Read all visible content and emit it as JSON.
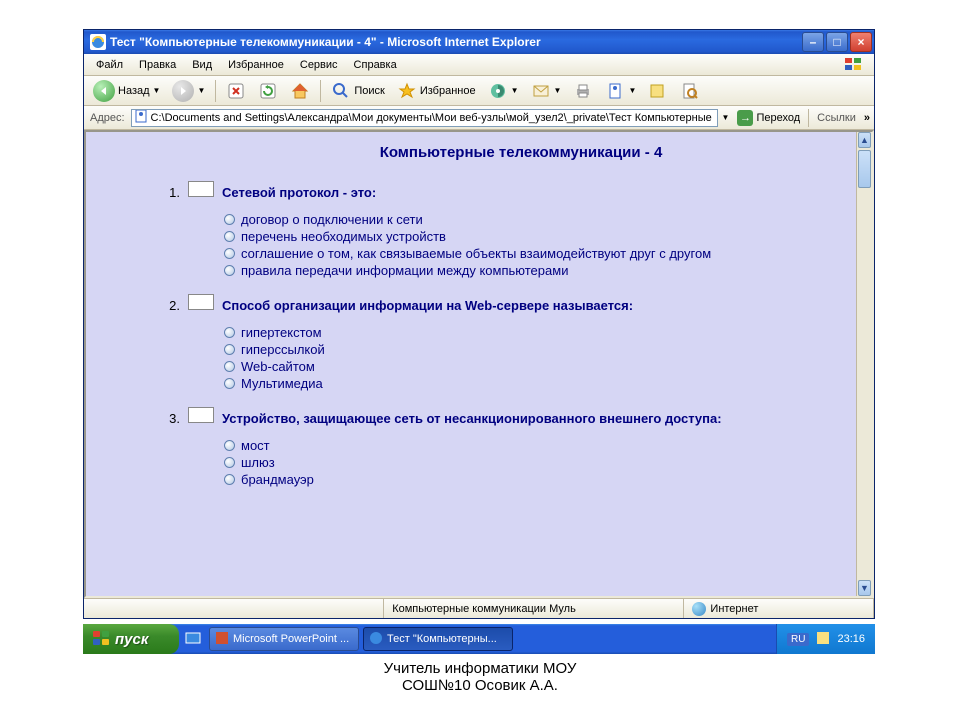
{
  "window": {
    "title": "Тест \"Компьютерные телекоммуникации - 4\" - Microsoft Internet Explorer"
  },
  "menu": [
    "Файл",
    "Правка",
    "Вид",
    "Избранное",
    "Сервис",
    "Справка"
  ],
  "toolbar": {
    "back": "Назад",
    "search": "Поиск",
    "favorites": "Избранное"
  },
  "address": {
    "label": "Адрес:",
    "value": "C:\\Documents and Settings\\Александра\\Мои документы\\Мои веб-узлы\\мой_узел2\\_private\\Тест Компьютерные",
    "go": "Переход",
    "links": "Ссылки"
  },
  "page": {
    "title": "Компьютерные телекоммуникации - 4",
    "questions": [
      {
        "num": "1.",
        "text": "Сетевой протокол - это:",
        "options": [
          "договор о подключении к сети",
          "перечень необходимых устройств",
          "соглашение о том, как связываемые объекты взаимодействуют друг с другом",
          "правила передачи информации между компьютерами"
        ]
      },
      {
        "num": "2.",
        "text": "Способ организации информации на  Web-сервере называется:",
        "options": [
          "гипертекстом",
          "гиперссылкой",
          "Web-сайтом",
          "Мультимедиа"
        ]
      },
      {
        "num": "3.",
        "text": "Устройство, защищающее сеть от несанкционированного внешнего доступа:",
        "options": [
          "мост",
          "шлюз",
          "брандмауэр"
        ]
      }
    ]
  },
  "status": {
    "doc": "Компьютерные коммуникации Муль",
    "zone": "Интернет"
  },
  "taskbar": {
    "start": "пуск",
    "tasks": [
      "Microsoft PowerPoint ...",
      "Тест \"Компьютерны..."
    ],
    "lang": "RU",
    "time": "23:16"
  },
  "footer": {
    "line1": "Учитель информатики МОУ",
    "line2": "СОШ№10 Осовик А.А."
  }
}
